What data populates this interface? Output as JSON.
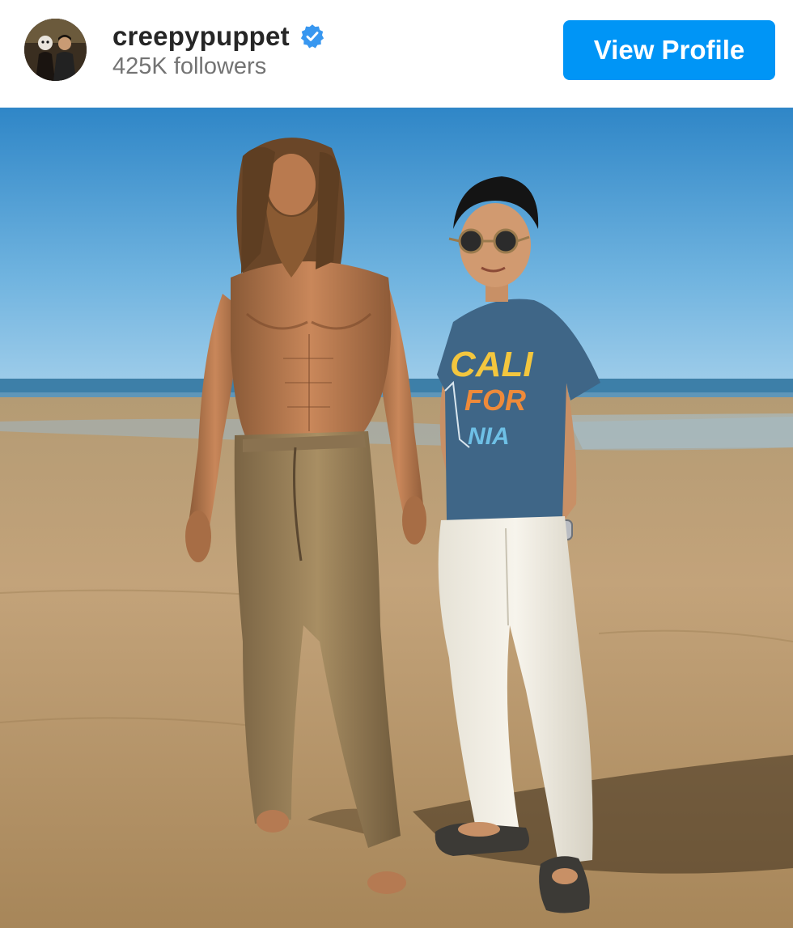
{
  "header": {
    "username": "creepypuppet",
    "verified_icon": "verified-badge-icon",
    "followers": "425K followers",
    "view_profile_label": "View Profile",
    "accent_color": "#0095f6"
  },
  "post": {
    "image": "beach-photo",
    "shirt_text_line1": "CALI",
    "shirt_text_line2": "FOR",
    "shirt_text_line3": "NIA"
  }
}
